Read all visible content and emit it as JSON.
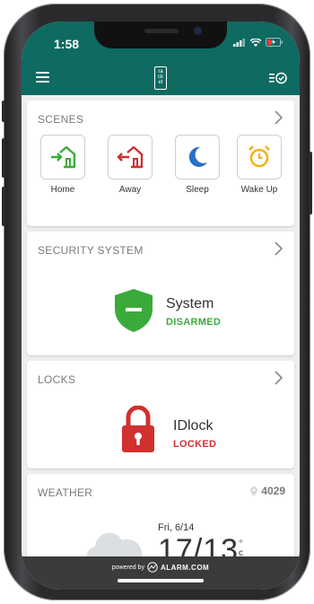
{
  "status_bar": {
    "time": "1:58"
  },
  "app": {
    "logo_text": "ra ck et"
  },
  "cards": {
    "scenes": {
      "title": "SCENES",
      "items": [
        {
          "label": "Home",
          "icon": "home-arrive-icon",
          "color": "#3aab3a"
        },
        {
          "label": "Away",
          "icon": "home-leave-icon",
          "color": "#d22f2f"
        },
        {
          "label": "Sleep",
          "icon": "moon-icon",
          "color": "#2a6fc9"
        },
        {
          "label": "Wake Up",
          "icon": "alarm-clock-icon",
          "color": "#f2b21b"
        }
      ]
    },
    "security": {
      "title": "SECURITY SYSTEM",
      "name": "System",
      "state": "DISARMED",
      "color": "#3aab3a"
    },
    "locks": {
      "title": "LOCKS",
      "name": "IDlock",
      "state": "LOCKED",
      "color": "#d22f2f"
    },
    "weather": {
      "title": "WEATHER",
      "location": "4029",
      "date": "Fri, 6/14",
      "temps": "17/13",
      "unit_top": "°",
      "unit_bottom": "c"
    }
  },
  "footer": {
    "powered_by": "powered by",
    "brand": "ALARM.COM"
  },
  "colors": {
    "header": "#0f6a61",
    "footer": "#3b3b3b"
  }
}
